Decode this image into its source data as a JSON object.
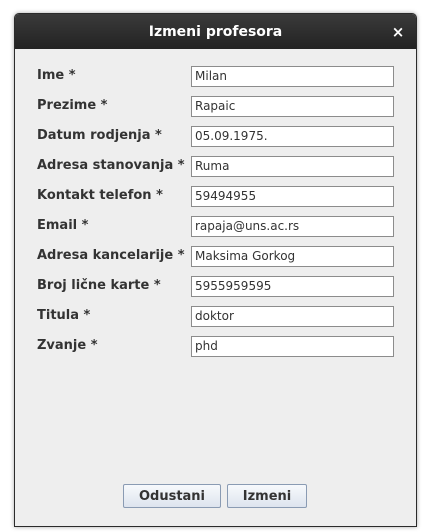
{
  "window": {
    "title": "Izmeni profesora",
    "close_glyph": "×"
  },
  "form": {
    "fields": [
      {
        "label": "Ime *",
        "value": "Milan"
      },
      {
        "label": "Prezime *",
        "value": "Rapaic"
      },
      {
        "label": "Datum rodjenja *",
        "value": "05.09.1975."
      },
      {
        "label": "Adresa stanovanja *",
        "value": "Ruma"
      },
      {
        "label": "Kontakt telefon *",
        "value": "59494955"
      },
      {
        "label": "Email *",
        "value": "rapaja@uns.ac.rs"
      },
      {
        "label": "Adresa kancelarije *",
        "value": "Maksima Gorkog"
      },
      {
        "label": "Broj lične karte *",
        "value": "5955959595"
      },
      {
        "label": "Titula *",
        "value": "doktor"
      },
      {
        "label": "Zvanje *",
        "value": "phd"
      }
    ]
  },
  "buttons": {
    "cancel_label": "Odustani",
    "save_label": "Izmeni"
  }
}
